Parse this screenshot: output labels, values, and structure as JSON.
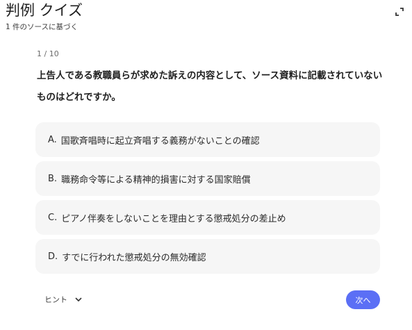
{
  "header": {
    "title": "判例 クイズ",
    "subtitle": "1 件のソースに基づく",
    "expand_icon": "expand-icon"
  },
  "quiz": {
    "progress": "1 / 10",
    "question": "上告人である教職員らが求めた訴えの内容として、ソース資料に記載されていないものはどれですか。",
    "options": [
      {
        "letter": "A.",
        "text": "国歌斉唱時に起立斉唱する義務がないことの確認"
      },
      {
        "letter": "B.",
        "text": "職務命令等による精神的損害に対する国家賠償"
      },
      {
        "letter": "C.",
        "text": "ピアノ伴奏をしないことを理由とする懲戒処分の差止め"
      },
      {
        "letter": "D.",
        "text": "すでに行われた懲戒処分の無効確認"
      }
    ]
  },
  "footer": {
    "hint_label": "ヒント",
    "hint_icon": "chevron-down-icon",
    "next_label": "次へ"
  },
  "colors": {
    "accent": "#5b6ff5",
    "option_bg": "#f6f6f6",
    "text": "#1f1f1f"
  }
}
